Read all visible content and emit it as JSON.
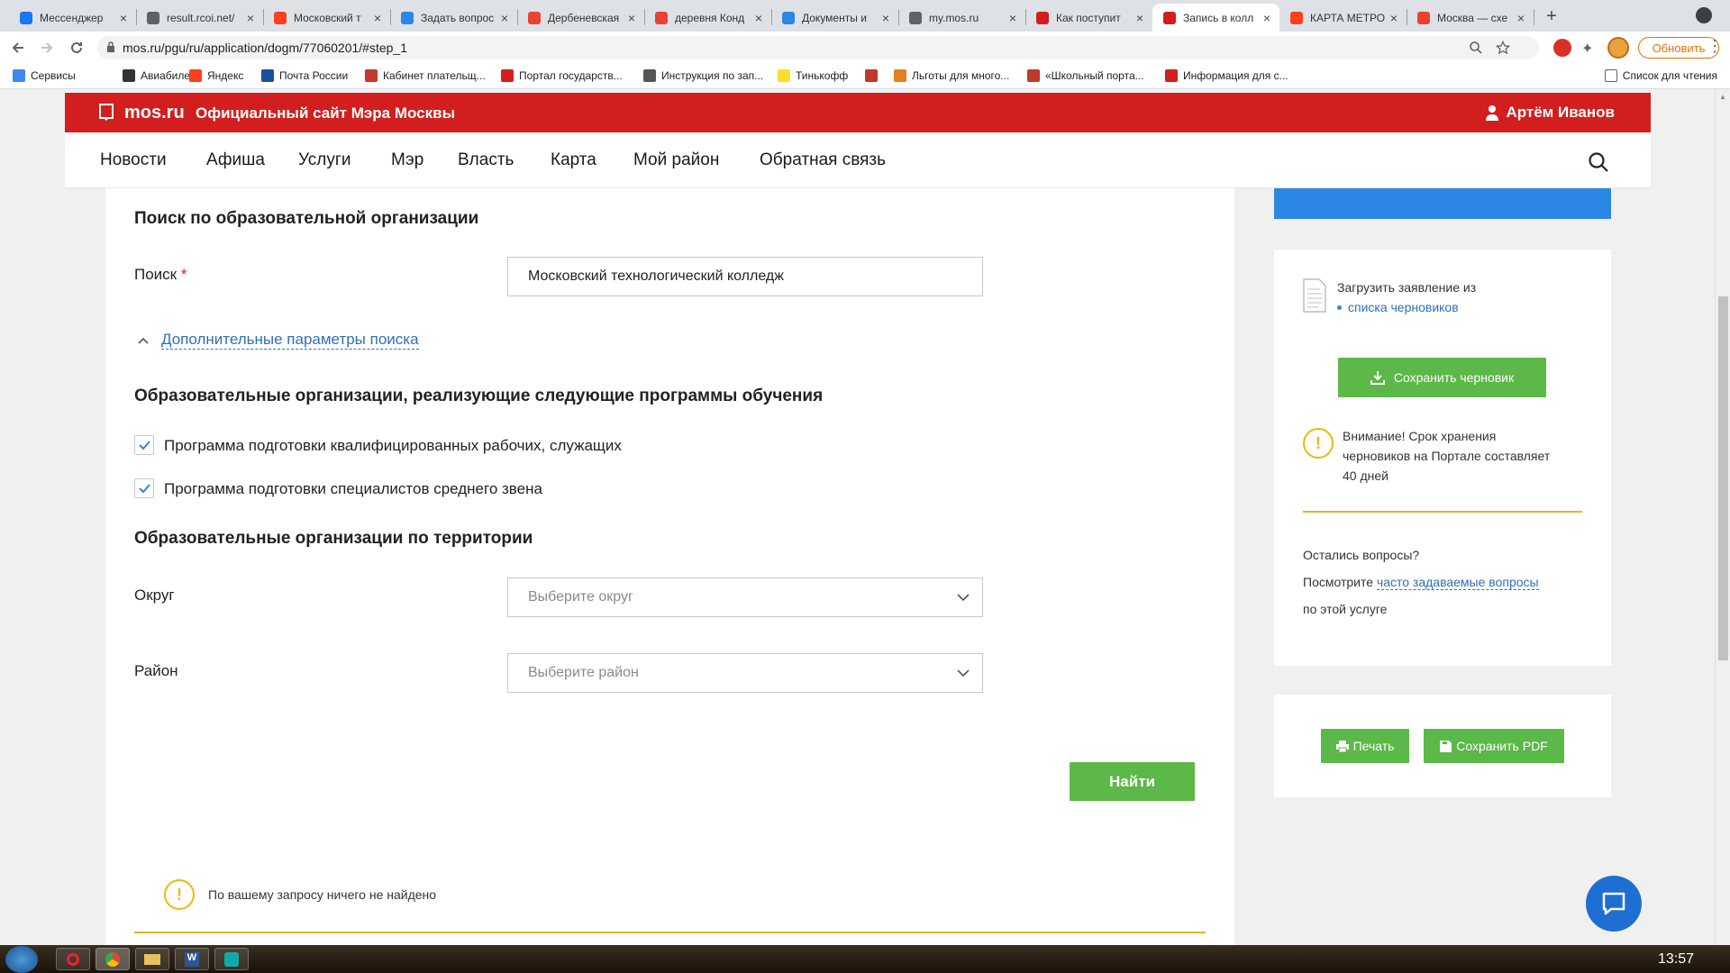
{
  "tabs": [
    {
      "title": "Мессенджер",
      "color": "#1877f2",
      "active": false
    },
    {
      "title": "result.rcoi.net/",
      "color": "#5f6368",
      "active": false
    },
    {
      "title": "Московский т",
      "color": "#fc3f1d",
      "active": false
    },
    {
      "title": "Задать вопрос",
      "color": "#2b87e3",
      "active": false
    },
    {
      "title": "Дербеневская",
      "color": "#ea4335",
      "active": false
    },
    {
      "title": "деревня Конд",
      "color": "#ea4335",
      "active": false
    },
    {
      "title": "Документы и",
      "color": "#2b87e3",
      "active": false
    },
    {
      "title": "my.mos.ru",
      "color": "#5f6368",
      "active": false
    },
    {
      "title": "Как поступит",
      "color": "#d21e1e",
      "active": false
    },
    {
      "title": "Запись в колл",
      "color": "#d21e1e",
      "active": true
    },
    {
      "title": "КАРТА МЕТРО",
      "color": "#fc3f1d",
      "active": false
    },
    {
      "title": "Москва — схе",
      "color": "#ea4335",
      "active": false
    }
  ],
  "address": {
    "url": "mos.ru/pgu/ru/application/dogm/77060201/#step_1",
    "update_label": "Обновить"
  },
  "bookmarks": [
    {
      "label": "Сервисы",
      "color": "#4285f4"
    },
    {
      "label": "Авиабилеты",
      "color": "#333333"
    },
    {
      "label": "Яндекс",
      "color": "#fc3f1d"
    },
    {
      "label": "Почта России",
      "color": "#1b4fa0"
    },
    {
      "label": "Кабинет плательщ...",
      "color": "#c0392b"
    },
    {
      "label": "Портал государств...",
      "color": "#d21e1e"
    },
    {
      "label": "Инструкция по зап...",
      "color": "#555555"
    },
    {
      "label": "Тинькофф",
      "color": "#ffdd2d"
    },
    {
      "label": "",
      "color": "#c0392b"
    },
    {
      "label": "Льготы для много...",
      "color": "#e67e22"
    },
    {
      "label": "«Школьный порта...",
      "color": "#c0392b"
    },
    {
      "label": "Информация для с...",
      "color": "#d21e1e"
    }
  ],
  "bookmarks_reading_list": "Список для чтения",
  "site": {
    "logo": "mos.ru",
    "tagline": "Официальный сайт Мэра Москвы",
    "user": "Артём Иванов",
    "nav": [
      "Новости",
      "Афиша",
      "Услуги",
      "Мэр",
      "Власть",
      "Карта",
      "Мой район",
      "Обратная связь"
    ]
  },
  "form": {
    "title_search": "Поиск по образовательной организации",
    "search_label": "Поиск",
    "required_mark": "*",
    "search_value": "Московский технологический колледж",
    "advanced_link": "Дополнительные параметры поиска",
    "title_programs": "Образовательные организации, реализующие следующие программы обучения",
    "programs": [
      {
        "label": "Программа подготовки квалифицированных рабочих, служащих",
        "checked": true
      },
      {
        "label": "Программа подготовки специалистов среднего звена",
        "checked": true
      }
    ],
    "title_territory": "Образовательные организации по территории",
    "district_label": "Округ",
    "district_placeholder": "Выберите округ",
    "area_label": "Район",
    "area_placeholder": "Выберите район",
    "find_button": "Найти",
    "no_results": "По вашему запросу ничего не найдено"
  },
  "sidebar": {
    "upload_text": "Загрузить заявление из",
    "drafts_link": "списка черновиков",
    "save_draft": "Сохранить черновик",
    "warning_lines": [
      "Внимание! Срок хранения",
      "черновиков на Портале составляет",
      "40 дней"
    ],
    "questions": "Остались вопросы?",
    "see_prefix": "Посмотрите",
    "faq_link": "часто задаваемые вопросы",
    "service_suffix": "по этой услуге",
    "print": "Печать",
    "save_pdf": "Сохранить PDF"
  },
  "clock": "13:57",
  "colors": {
    "red": "#d21e1e",
    "green": "#5cb848",
    "blue": "#2b87e3",
    "warning": "#f2b705"
  }
}
